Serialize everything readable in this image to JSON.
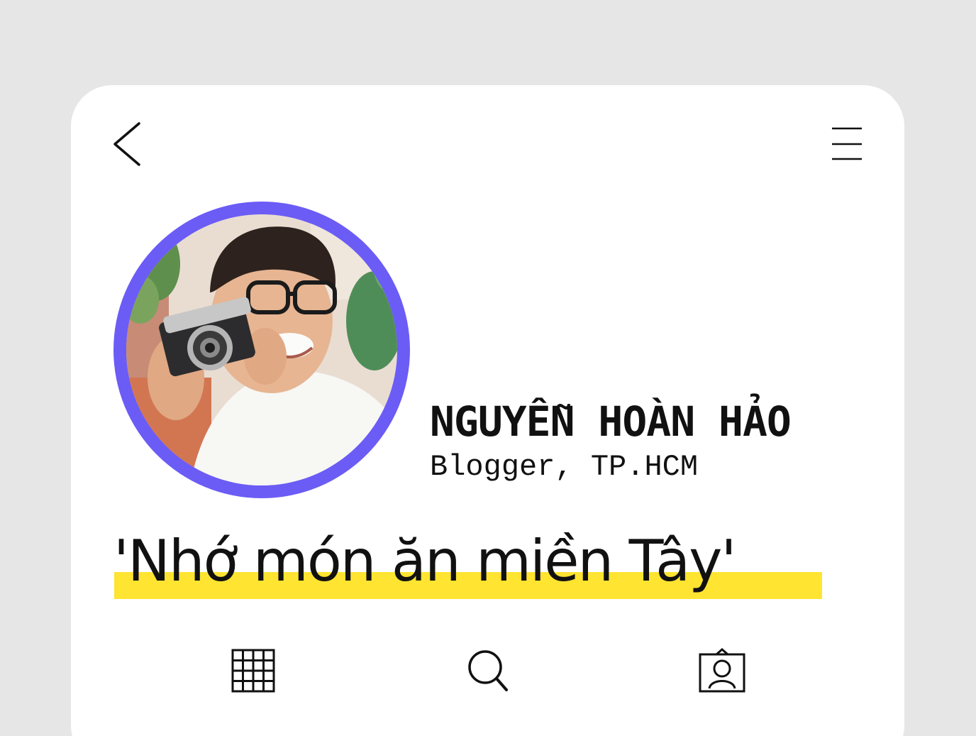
{
  "profile": {
    "name": "NGUYỄN HOÀN HẢO",
    "subtitle": "Blogger, TP.HCM",
    "quote": "'Nhớ món ăn miền Tây'"
  },
  "icons": {
    "back": "chevron-left-icon",
    "menu": "hamburger-menu-icon",
    "grid": "grid-icon",
    "search": "search-icon",
    "profile": "profile-card-icon"
  },
  "colors": {
    "background": "#e6e6e6",
    "card": "#ffffff",
    "avatar_ring": "#6b5cf6",
    "highlight": "#ffe431",
    "text": "#111111"
  }
}
